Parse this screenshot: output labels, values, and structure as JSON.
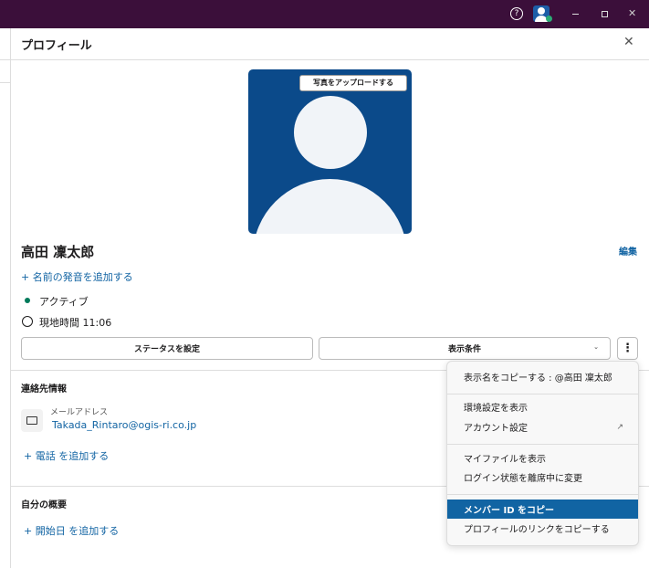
{
  "titlebar": {
    "help_icon": "?",
    "window_controls": [
      "minimize",
      "restore",
      "close"
    ]
  },
  "panel": {
    "title": "プロフィール",
    "upload_photo": "写真をアップロードする",
    "name": "高田 凜太郎",
    "edit": "編集",
    "add_pronunciation": "名前の発音を追加する",
    "status": "アクティブ",
    "local_time_label": "現地時間",
    "local_time": "11:06",
    "set_status": "ステータスを設定",
    "view_options": "表示条件"
  },
  "contact": {
    "heading": "連絡先情報",
    "email_label": "メールアドレス",
    "email": "Takada_Rintaro@ogis-ri.co.jp",
    "add_phone": "電話 を追加する"
  },
  "about": {
    "heading": "自分の概要",
    "add_start_date": "開始日 を追加する"
  },
  "menu": {
    "items": [
      "表示名をコピーする : @高田 凜太郎",
      "環境設定を表示",
      "アカウント設定",
      "マイファイルを表示",
      "ログイン状態を離席中に変更",
      "メンバー ID をコピー",
      "プロフィールのリンクをコピーする"
    ],
    "selected": "メンバー ID をコピー"
  },
  "colors": {
    "topbar": "#3b0f3a",
    "accent": "#1264a3",
    "avatar_bg": "#0b4a8a",
    "active": "#007a5a"
  }
}
